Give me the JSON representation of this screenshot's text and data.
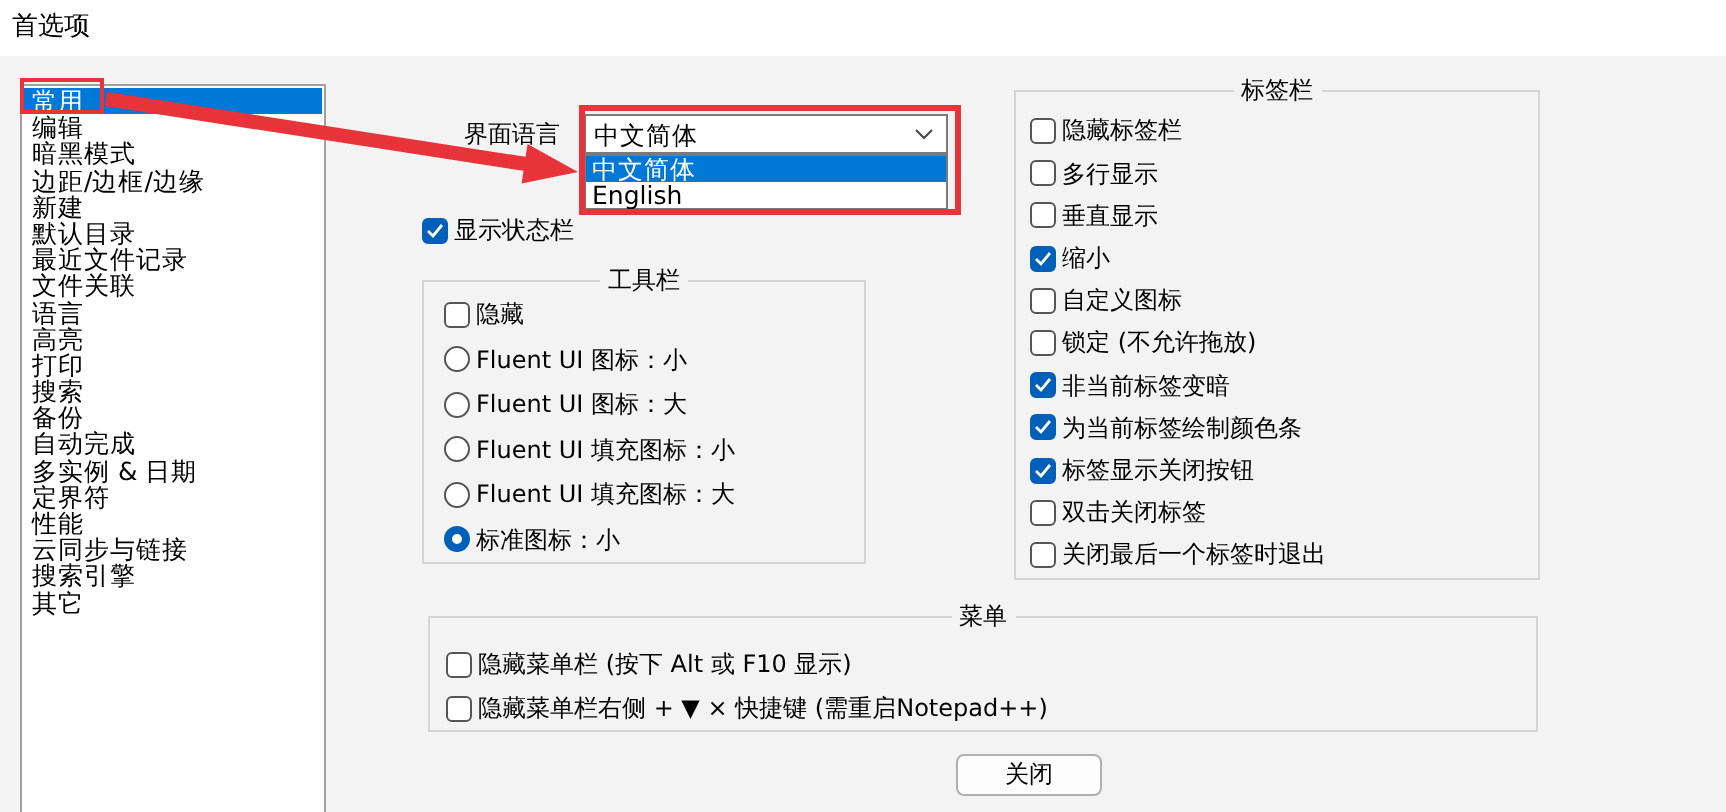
{
  "window": {
    "title": "首选项"
  },
  "categories": [
    {
      "label": "常用",
      "selected": true
    },
    {
      "label": "编辑",
      "selected": false
    },
    {
      "label": "暗黑模式",
      "selected": false
    },
    {
      "label": "边距/边框/边缘",
      "selected": false
    },
    {
      "label": "新建",
      "selected": false
    },
    {
      "label": "默认目录",
      "selected": false
    },
    {
      "label": "最近文件记录",
      "selected": false
    },
    {
      "label": "文件关联",
      "selected": false
    },
    {
      "label": "语言",
      "selected": false
    },
    {
      "label": "高亮",
      "selected": false
    },
    {
      "label": "打印",
      "selected": false
    },
    {
      "label": "搜索",
      "selected": false
    },
    {
      "label": "备份",
      "selected": false
    },
    {
      "label": "自动完成",
      "selected": false
    },
    {
      "label": "多实例 & 日期",
      "selected": false
    },
    {
      "label": "定界符",
      "selected": false
    },
    {
      "label": "性能",
      "selected": false
    },
    {
      "label": "云同步与链接",
      "selected": false
    },
    {
      "label": "搜索引擎",
      "selected": false
    },
    {
      "label": "其它",
      "selected": false
    }
  ],
  "language": {
    "label": "界面语言",
    "value": "中文简体",
    "expanded": true,
    "options": [
      {
        "text": "中文简体",
        "selected": true
      },
      {
        "text": "English",
        "selected": false
      }
    ]
  },
  "status_bar_option": {
    "label": "显示状态栏",
    "checked": true
  },
  "toolbar": {
    "title": "工具栏",
    "items": [
      {
        "kind": "checkbox",
        "label": "隐藏",
        "checked": false
      },
      {
        "kind": "radio",
        "label": "Fluent UI 图标：小",
        "selected": false
      },
      {
        "kind": "radio",
        "label": "Fluent UI 图标：大",
        "selected": false
      },
      {
        "kind": "radio",
        "label": "Fluent UI 填充图标：小",
        "selected": false
      },
      {
        "kind": "radio",
        "label": "Fluent UI 填充图标：大",
        "selected": false
      },
      {
        "kind": "radio",
        "label": "标准图标：小",
        "selected": true
      }
    ]
  },
  "tabbar": {
    "title": "标签栏",
    "items": [
      {
        "label": "隐藏标签栏",
        "checked": false
      },
      {
        "label": "多行显示",
        "checked": false
      },
      {
        "label": "垂直显示",
        "checked": false
      },
      {
        "label": "缩小",
        "checked": true
      },
      {
        "label": "自定义图标",
        "checked": false
      },
      {
        "label": "锁定 (不允许拖放)",
        "checked": false
      },
      {
        "label": "非当前标签变暗",
        "checked": true
      },
      {
        "label": "为当前标签绘制颜色条",
        "checked": true
      },
      {
        "label": "标签显示关闭按钮",
        "checked": true
      },
      {
        "label": "双击关闭标签",
        "checked": false
      },
      {
        "label": "关闭最后一个标签时退出",
        "checked": false
      }
    ]
  },
  "menu": {
    "title": "菜单",
    "items": [
      {
        "label": "隐藏菜单栏 (按下 Alt 或 F10 显示)",
        "checked": false
      },
      {
        "label": "隐藏菜单栏右侧 + ▼ × 快捷键 (需重启Notepad++)",
        "checked": false
      }
    ]
  },
  "buttons": [
    "关闭"
  ]
}
